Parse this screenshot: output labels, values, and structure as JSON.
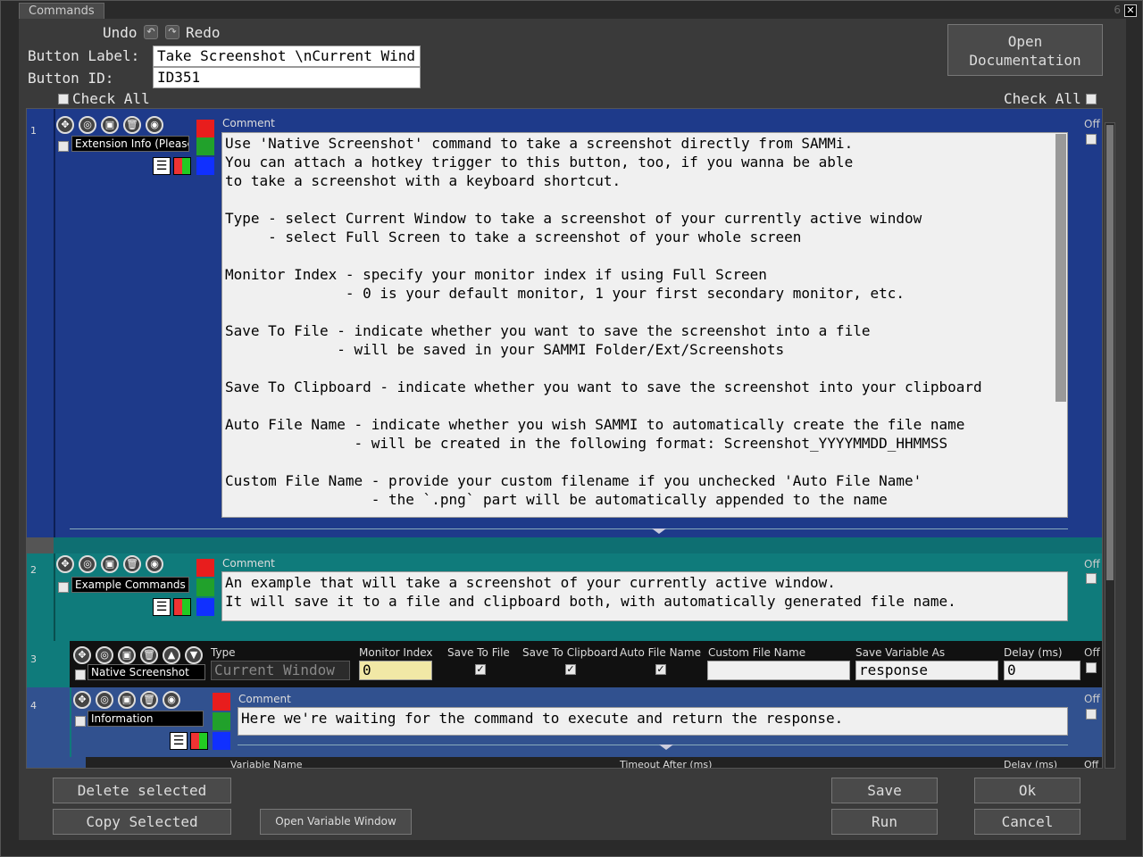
{
  "window": {
    "title": "Commands",
    "close": "✕"
  },
  "toolbar": {
    "undo": "Undo",
    "redo": "Redo",
    "open_docs_line1": "Open",
    "open_docs_line2": "Documentation"
  },
  "button_label": {
    "label": "Button Label:",
    "value": "Take Screenshot \\nCurrent Wind"
  },
  "button_id": {
    "label": "Button ID:",
    "value": "ID351"
  },
  "check_all_left": "Check All",
  "check_all_right": "Check All",
  "rows": [
    {
      "num": "1",
      "name": "Extension Info (Please",
      "comment_label": "Comment",
      "off": "Off",
      "comment": "Use 'Native Screenshot' command to take a screenshot directly from SAMMi.\nYou can attach a hotkey trigger to this button, too, if you wanna be able\nto take a screenshot with a keyboard shortcut.\n\nType - select Current Window to take a screenshot of your currently active window\n     - select Full Screen to take a screenshot of your whole screen\n\nMonitor Index - specify your monitor index if using Full Screen\n              - 0 is your default monitor, 1 your first secondary monitor, etc.\n\nSave To File - indicate whether you want to save the screenshot into a file\n             - will be saved in your SAMMI Folder/Ext/Screenshots\n\nSave To Clipboard - indicate whether you want to save the screenshot into your clipboard\n\nAuto File Name - indicate whether you wish SAMMI to automatically create the file name\n               - will be created in the following format: Screenshot_YYYYMMDD_HHMMSS\n\nCustom File Name - provide your custom filename if you unchecked 'Auto File Name'\n                 - the `.png` part will be automatically appended to the name"
    },
    {
      "num": "2",
      "name": "Example Commands (",
      "comment_label": "Comment",
      "off": "Off",
      "comment": "An example that will take a screenshot of your currently active window.\nIt will save it to a file and clipboard both, with automatically generated file name."
    },
    {
      "num": "3",
      "name": "Native Screenshot",
      "off": "Off",
      "headers": {
        "type": "Type",
        "monitor": "Monitor Index",
        "save_file": "Save To File",
        "save_clip": "Save To Clipboard",
        "auto_name": "Auto File Name",
        "custom_name": "Custom File Name",
        "save_var": "Save Variable As",
        "delay": "Delay (ms)"
      },
      "values": {
        "type": "Current Window",
        "monitor": "0",
        "custom_name": "",
        "save_var": "response",
        "delay": "0"
      }
    },
    {
      "num": "4",
      "name": "Information",
      "comment_label": "Comment",
      "off": "Off",
      "comment": "Here we're waiting for the command to execute and return the response."
    },
    {
      "num": "",
      "headers": {
        "var_name": "Variable Name",
        "timeout": "Timeout After (ms)",
        "delay": "Delay (ms)",
        "off": "Off"
      }
    }
  ],
  "bottom": {
    "delete": "Delete selected",
    "copy": "Copy Selected",
    "open_var": "Open Variable Window",
    "save": "Save",
    "ok": "Ok",
    "run": "Run",
    "cancel": "Cancel"
  },
  "colors": {
    "row1": "#1e3a8a",
    "row2": "#0f7b7b",
    "row3": "#111111",
    "row4": "#31518f"
  }
}
